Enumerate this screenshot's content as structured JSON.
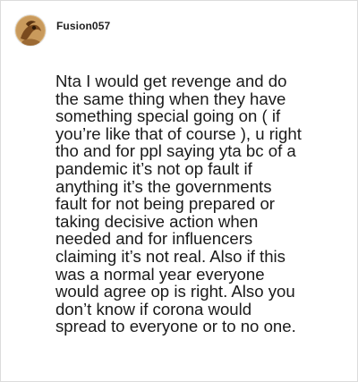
{
  "comment": {
    "author": {
      "username": "Fusion057",
      "avatar_icon": "user-avatar-icon"
    },
    "body": "Nta I would get revenge and do\nthe same thing when they have\nsomething special going on ( if\nyou’re like that of course ), u right\ntho and for ppl saying yta bc of a\npandemic it’s not op fault if\nanything it’s the governments\nfault for not being prepared or\ntaking decisive action when\nneeded and for influencers\nclaiming it’s not real. Also if this\nwas a normal year everyone\nwould agree op is right. Also you\ndon’t know if corona would\nspread to everyone or to no one."
  },
  "colors": {
    "text": "#1a1a1a",
    "border": "#dcdcdc",
    "avatar_bg": "#c9a46b",
    "avatar_fg": "#6b3f18"
  }
}
